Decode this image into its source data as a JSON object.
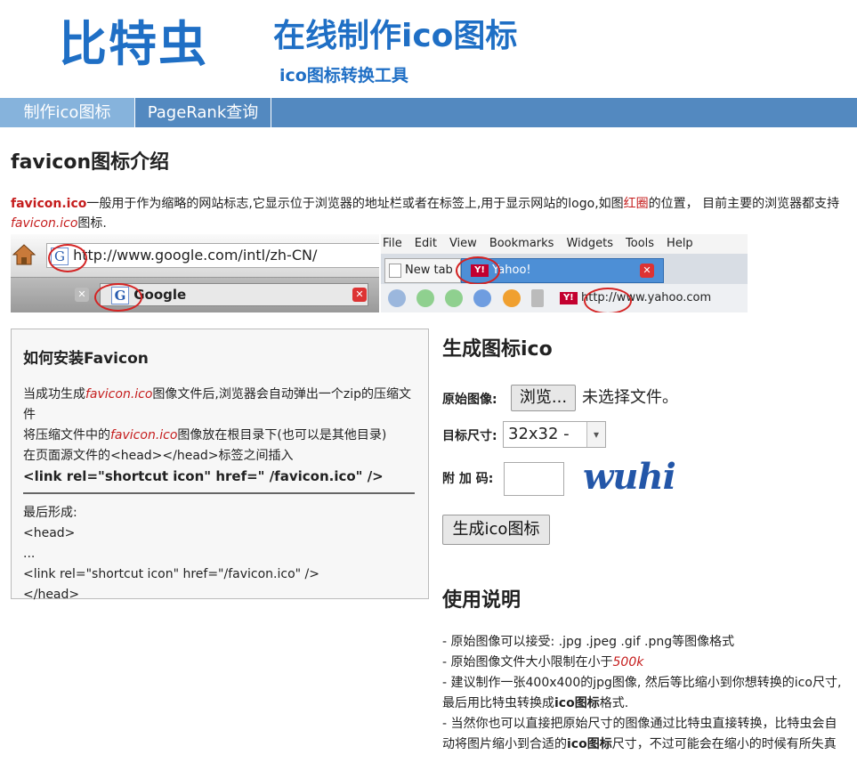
{
  "header": {
    "logo": "比特虫",
    "title": "在线制作ico图标",
    "subtitle": "ico图标转换工具"
  },
  "nav": {
    "items": [
      {
        "label": "制作ico图标",
        "active": true
      },
      {
        "label": "PageRank查询",
        "active": false
      }
    ]
  },
  "intro": {
    "heading": "favicon图标介绍",
    "p1_term": "favicon.ico",
    "p1_text": "一般用于作为缩略的网站标志,它显示位于浏览器的地址栏或者在标签上,用于显示网站的logo,如图",
    "p1_red": "红圈",
    "p1_text2": "的位置， 目前主要的浏览器都支持",
    "p1_italic": "favicon.ico",
    "p1_end": "图标."
  },
  "screenshot": {
    "left_url": "http://www.google.com/intl/zh-CN/",
    "left_tab": "Google",
    "menu": [
      "File",
      "Edit",
      "View",
      "Bookmarks",
      "Widgets",
      "Tools",
      "Help"
    ],
    "tab_new": "New tab",
    "tab_yahoo": "Yahoo!",
    "right_url": "http://www.yahoo.com"
  },
  "install": {
    "heading": "如何安装Favicon",
    "l1a": "当成功生成",
    "l1_i": "favicon.ico",
    "l1b": "图像文件后,浏览器会自动弹出一个zip的压缩文件",
    "l2a": "将压缩文件中的",
    "l2_i": "favicon.ico",
    "l2b": "图像放在根目录下(也可以是其他目录)",
    "l3": "在页面源文件的<head></head>标签之间插入",
    "code": "<link rel=\"shortcut icon\" href=\" /favicon.ico\" />",
    "final_label": "最后形成:",
    "f1": "<head>",
    "f2": "...",
    "f3": "<link rel=\"shortcut icon\" href=\"/favicon.ico\" />",
    "f4": "</head>"
  },
  "generator": {
    "heading": "生成图标ico",
    "orig_label": "原始图像:",
    "browse_button": "浏览...",
    "no_file": "未选择文件。",
    "size_label": "目标尺寸:",
    "size_value": "32x32 -",
    "captcha_label": "附 加 码:",
    "captcha_text": "wuhi",
    "submit_button": "生成ico图标"
  },
  "usage": {
    "heading": "使用说明",
    "u1": "- 原始图像可以接受: .jpg .jpeg .gif .png等图像格式",
    "u2a": "- 原始图像文件大小限制在小于",
    "u2_i": "500k",
    "u3a": "- 建议制作一张400x400的jpg图像, 然后等比缩小到你想转换的ico尺寸,最后用比特虫转换成",
    "u3_b": "ico图标",
    "u3c": "格式.",
    "u4a": "- 当然你也可以直接把原始尺寸的图像通过比特虫直接转换，比特虫会自动将图片缩小到合适的",
    "u4_b": "ico图标",
    "u4c": "尺寸，不过可能会在缩小的时候有所失真"
  },
  "colors": {
    "brand": "#1f6fc5",
    "nav": "#5389c0",
    "nav_active": "#86b3dc",
    "accent_red": "#c51d1d"
  }
}
